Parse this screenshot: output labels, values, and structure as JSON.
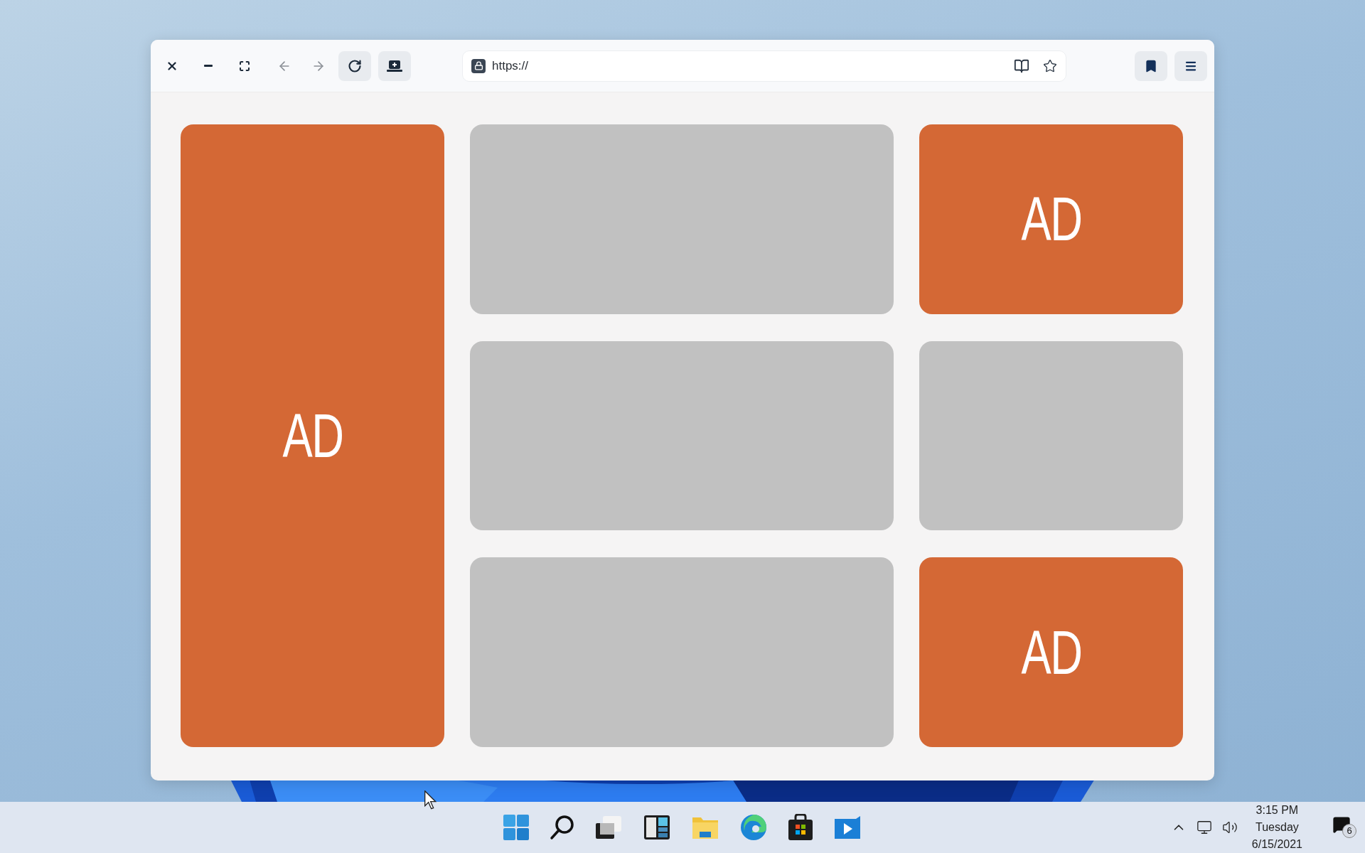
{
  "browser": {
    "address": "https://"
  },
  "columns": [
    {
      "tiles": [
        {
          "kind": "ad",
          "label": "AD"
        }
      ]
    },
    {
      "tiles": [
        {
          "kind": "blank"
        },
        {
          "kind": "blank"
        },
        {
          "kind": "blank"
        }
      ]
    },
    {
      "tiles": [
        {
          "kind": "ad",
          "label": "AD"
        },
        {
          "kind": "blank"
        },
        {
          "kind": "ad",
          "label": "AD"
        }
      ]
    }
  ],
  "taskbar": {
    "time": "3:15 PM",
    "day": "Tuesday",
    "date": "6/15/2021",
    "notifications": "6"
  }
}
